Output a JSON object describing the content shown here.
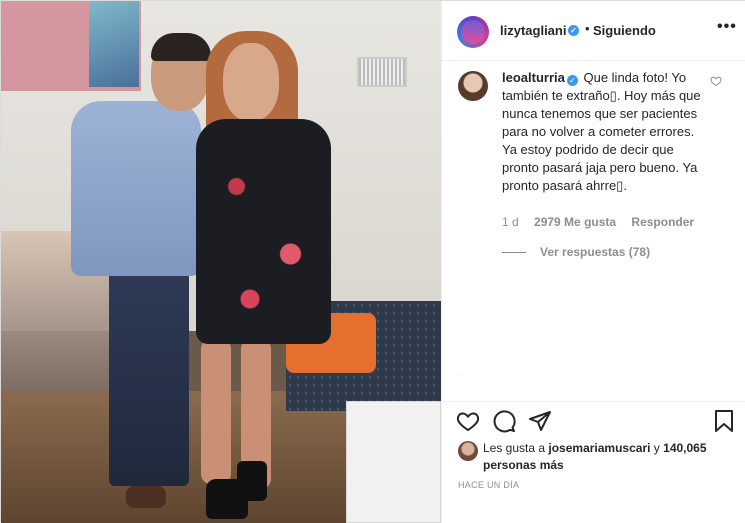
{
  "post": {
    "username": "lizytagliani",
    "verified_mark": "✓",
    "separator": "•",
    "follow_status": "Siguiendo",
    "more_icon": "•••"
  },
  "comment": {
    "username": "leoalturria",
    "verified_mark": "✓",
    "text": "Que linda foto! Yo también te extraño▯. Hoy más que nunca tenemos que ser pacientes para no volver a cometer errores. Ya estoy podrido de decir que pronto pasará jaja pero bueno. Ya pronto pasará ahrre▯.",
    "time": "1 d",
    "likes": "2979 Me gusta",
    "reply": "Responder",
    "view_replies": "Ver respuestas (78)"
  },
  "actions": {
    "like_icon": "heart-icon",
    "comment_icon": "comment-icon",
    "share_icon": "share-icon",
    "save_icon": "bookmark-icon"
  },
  "likes": {
    "prefix": "Les gusta a",
    "user": "josemariamuscari",
    "middle": "y",
    "count": "140,065 personas más"
  },
  "timestamp": "HACE UN DÍA",
  "photo_mark": "·",
  "colors": {
    "verified": "#3897f0",
    "text": "#262626",
    "muted": "#8e8e8e",
    "border": "#efefef"
  }
}
